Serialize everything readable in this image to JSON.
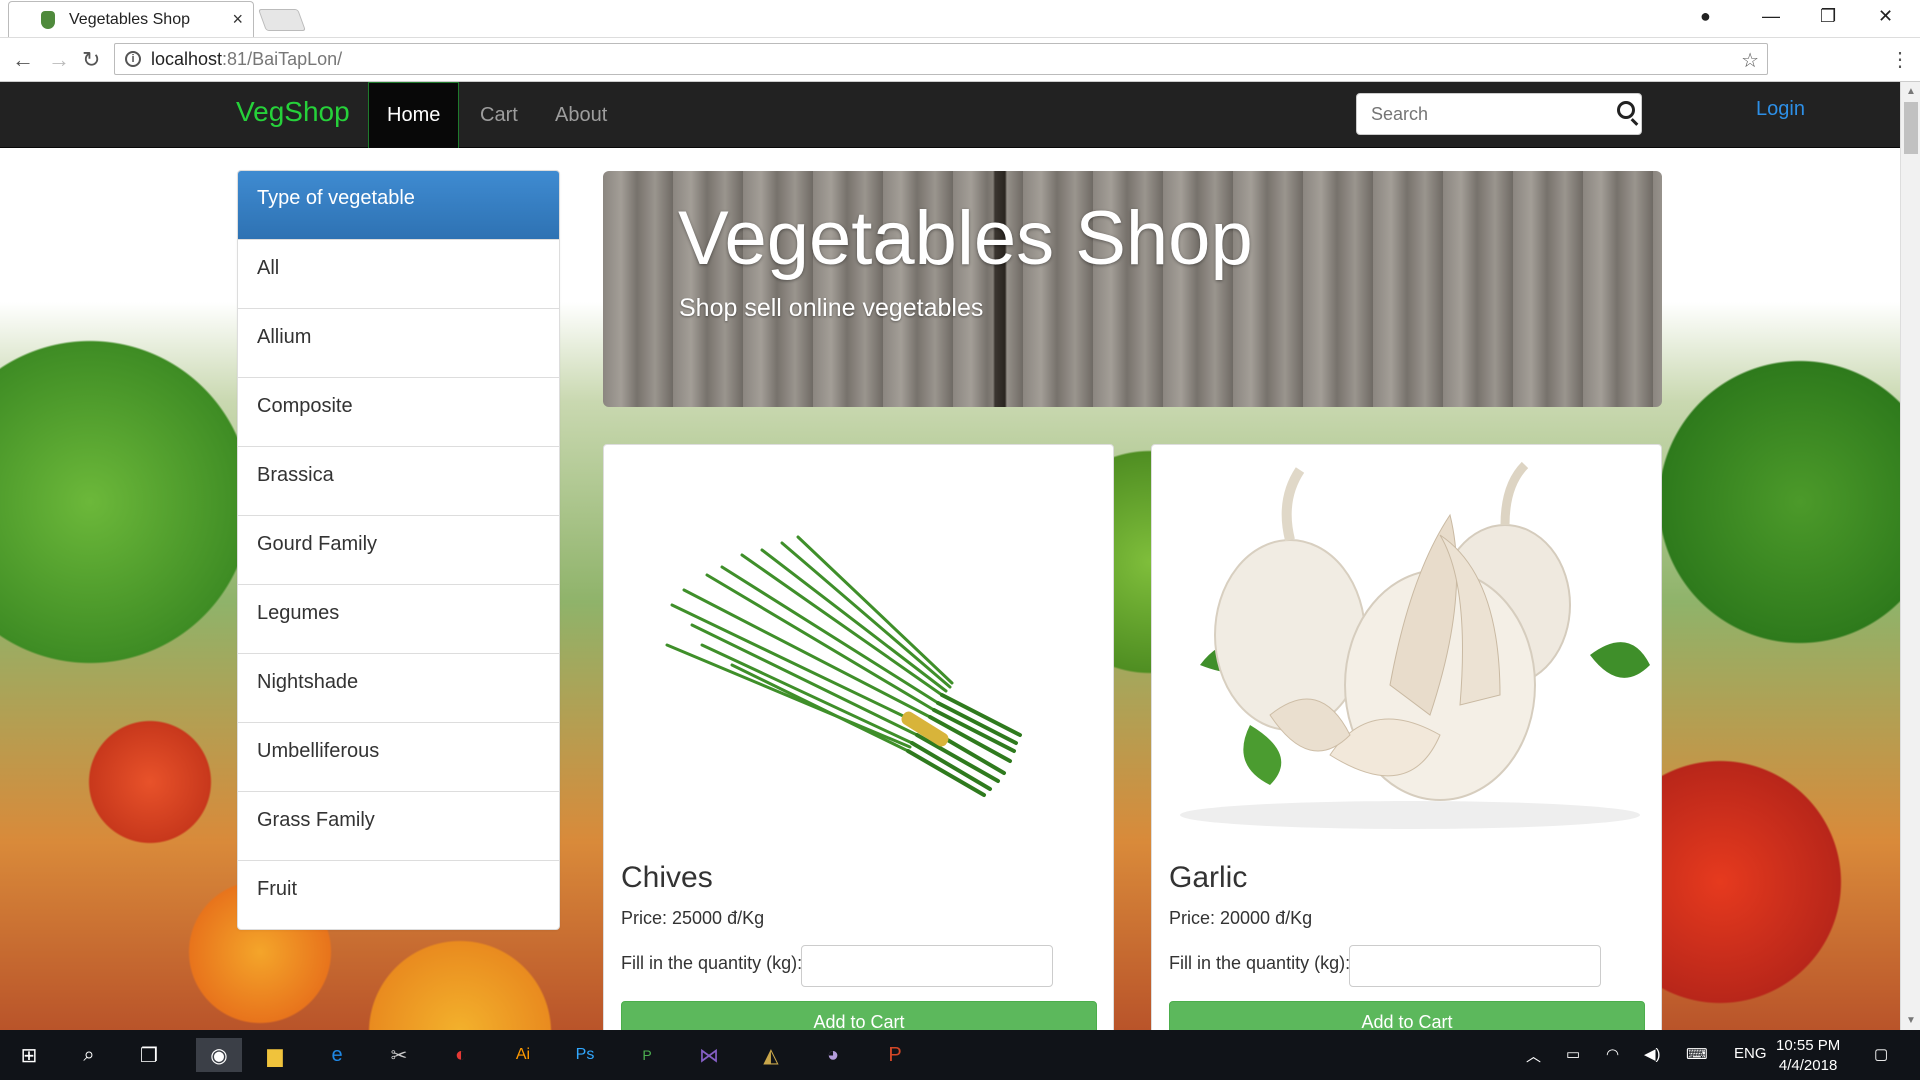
{
  "browser": {
    "tab_title": "Vegetables Shop",
    "tab_close": "×",
    "url_host": "localhost",
    "url_rest": ":81/BaiTapLon/",
    "window_controls": {
      "minimize": "—",
      "restore": "❐",
      "close": "✕"
    }
  },
  "navbar": {
    "brand": "VegShop",
    "links": [
      {
        "label": "Home",
        "active": true
      },
      {
        "label": "Cart",
        "active": false
      },
      {
        "label": "About",
        "active": false
      }
    ],
    "search_placeholder": "Search",
    "login": "Login"
  },
  "sidebar": {
    "heading": "Type of vegetable",
    "items": [
      "All",
      "Allium",
      "Composite",
      "Brassica",
      "Gourd Family",
      "Legumes",
      "Nightshade",
      "Umbelliferous",
      "Grass Family",
      "Fruit"
    ]
  },
  "jumbotron": {
    "title": "Vegetables Shop",
    "subtitle": "Shop sell online vegetables"
  },
  "products": [
    {
      "name": "Chives",
      "price": "Price: 25000 đ/Kg",
      "qty_label": "Fill in the quantity (kg):",
      "button": "Add to Cart",
      "image": "chives"
    },
    {
      "name": "Garlic",
      "price": "Price: 20000 đ/Kg",
      "qty_label": "Fill in the quantity (kg):",
      "button": "Add to Cart",
      "image": "garlic"
    }
  ],
  "taskbar": {
    "language": "ENG",
    "time": "10:55 PM",
    "date": "4/4/2018"
  },
  "colors": {
    "brand_green": "#26d13a",
    "navbar_bg": "#222222",
    "sidebar_header": "#337ab7",
    "add_button": "#5cb85c",
    "login_link": "#2d8fe6"
  }
}
